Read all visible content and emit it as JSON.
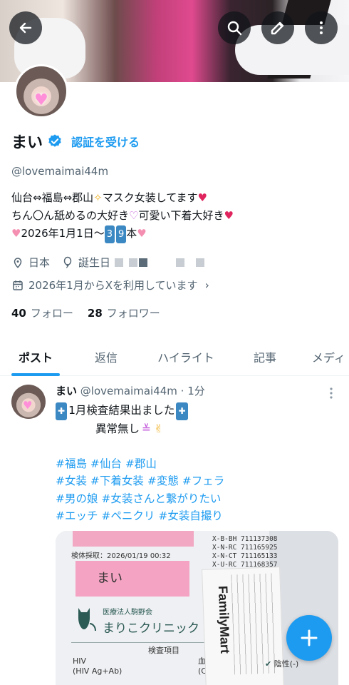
{
  "colors": {
    "accent": "#1d9bf0",
    "text": "#0f1419",
    "secondary": "#536471"
  },
  "header": {
    "back_icon": "arrow-left-icon",
    "search_icon": "search-icon",
    "edit_icon": "pencil-icon",
    "more_icon": "more-vertical-icon"
  },
  "profile": {
    "name": "まい",
    "verify_label": "認証を受ける",
    "handle": "@lovemaimai44m",
    "bio_line1_a": "仙台⇔福島⇔郡山",
    "bio_line1_b": "マスク女装してます",
    "bio_line2_a": "ちん〇ん舐めるの大好き",
    "bio_line2_b": "可愛い下着大好き",
    "bio_line3_a": "2026年1月1日〜",
    "bio_line3_b": "本",
    "location": "日本",
    "birthday_label": "誕生日",
    "joined": "2026年1月からXを利用しています",
    "following_count": "40",
    "following_label": "フォロー",
    "followers_count": "28",
    "followers_label": "フォロワー"
  },
  "tabs": [
    "ポスト",
    "返信",
    "ハイライト",
    "記事",
    "メディ"
  ],
  "post": {
    "name": "まい",
    "handle_time": "@lovemaimai44m · 1分",
    "line1": "1月検査結果出ました",
    "line2": "異常無し",
    "hashtags_line1": "#福島 #仙台 #郡山",
    "hashtags_line2": "#女装 #下着女装 #変態 #フェラ",
    "hashtags_line3": "#男の娘 #女装さんと繋がりたい",
    "hashtags_line4": "#エッチ #ペニクリ #女装自撮り"
  },
  "media": {
    "label_date": "検体採取：2026/01/19 00:32",
    "handwritten": "まい",
    "codes": [
      "X-B-BH 711137308",
      "X-N-RC 711165925",
      "X-N-CT 711165133",
      "X-U-RC 711168357"
    ],
    "clinic_small": "医療法人駒野会",
    "clinic_name": "まりこクリニック",
    "table_header": "検査項目",
    "hiv": "HIV",
    "hiv_sub": "(HIV Ag+Ab)",
    "method": "血液検査",
    "method_sub": "(CLEIA法)",
    "result": "陰性(-)",
    "receipt_brand": "FamilyMart"
  },
  "fab_icon": "plus-icon"
}
